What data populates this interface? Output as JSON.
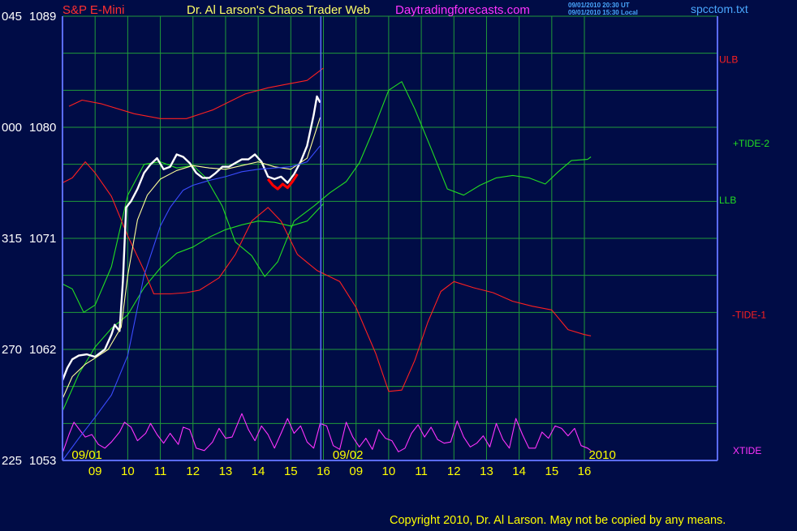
{
  "colors": {
    "background": "#000c46",
    "grid": "#1f9a3a",
    "axis_frame": "#5a6cff",
    "price_text": "#ffffff",
    "axis_label": "#ffff00",
    "title_symbol": "#ff3030",
    "title_main": "#ffff66",
    "website": "#ff33ff",
    "file_name": "#4aa8ff",
    "timestamp": "#4aa8ff",
    "ulb": "#ff2020",
    "llb": "#22dd22",
    "tide_plus2": "#22dd22",
    "tide_minus1": "#ff2020",
    "xtide": "#ff33ff",
    "price": "#ffffff",
    "price_down": "#ff0000",
    "avg_fast": "#ffff99",
    "avg_slow": "#3a4cff",
    "copyright": "#ffff00"
  },
  "header": {
    "symbol": "S&P E-Mini",
    "title": "Dr. Al Larson's Chaos Trader Web",
    "website": "Daytradingforecasts.com",
    "timestamp_ut": "09/01/2010 20:30 UT",
    "timestamp_local": "09/01/2010 15:30 Local",
    "file_name": "spcctom.txt"
  },
  "footer": {
    "copyright": "Copyright 2010, Dr. Al Larson. May not be copied by any means."
  },
  "chart_data": {
    "type": "line",
    "title": "S&P E-Mini",
    "y_axis": {
      "ylim": [
        1053,
        1089
      ],
      "ticks": [
        {
          "value": 1089,
          "left": "045",
          "right": "1089"
        },
        {
          "value": 1080,
          "left": "000",
          "right": "1080"
        },
        {
          "value": 1071,
          "left": "315",
          "right": "1071"
        },
        {
          "value": 1062,
          "left": "270",
          "right": "1062"
        },
        {
          "value": 1053,
          "left": "225",
          "right": "1053"
        }
      ]
    },
    "x_axis": {
      "xlim": [
        0,
        20.08
      ],
      "hour_ticks": [
        {
          "x": 1,
          "label": "09"
        },
        {
          "x": 2,
          "label": "10"
        },
        {
          "x": 3,
          "label": "11"
        },
        {
          "x": 4,
          "label": "12"
        },
        {
          "x": 5,
          "label": "13"
        },
        {
          "x": 6,
          "label": "14"
        },
        {
          "x": 7,
          "label": "15"
        },
        {
          "x": 8,
          "label": "16"
        },
        {
          "x": 9,
          "label": "09"
        },
        {
          "x": 10,
          "label": "10"
        },
        {
          "x": 11,
          "label": "11"
        },
        {
          "x": 12,
          "label": "12"
        },
        {
          "x": 13,
          "label": "13"
        },
        {
          "x": 14,
          "label": "14"
        },
        {
          "x": 15,
          "label": "15"
        },
        {
          "x": 16,
          "label": "16"
        }
      ],
      "date_labels": [
        {
          "x": 0.75,
          "label": "09/01"
        },
        {
          "x": 8.75,
          "label": "09/02"
        },
        {
          "x": 16.55,
          "label": "2010"
        }
      ],
      "day_divider": 7.92
    },
    "grid": true,
    "series_labels": [
      {
        "name": "ULB",
        "color_key": "ulb",
        "y": 1085.5
      },
      {
        "name": "+TIDE-2",
        "color_key": "tide_plus2",
        "y": 1078.7
      },
      {
        "name": "LLB",
        "color_key": "llb",
        "y": 1074.1
      },
      {
        "name": "-TIDE-1",
        "color_key": "tide_minus1",
        "y": 1064.8
      },
      {
        "name": "XTIDE",
        "color_key": "xtide",
        "y": 1053.8
      }
    ],
    "series": [
      {
        "name": "ULB",
        "color_key": "ulb",
        "x": [
          0.2,
          0.6,
          1.2,
          2.2,
          3.0,
          3.8,
          4.6,
          5.6,
          6.3,
          6.9,
          7.5,
          8.0
        ],
        "y": [
          1081.7,
          1082.2,
          1081.9,
          1081.1,
          1080.7,
          1080.7,
          1081.4,
          1082.7,
          1083.2,
          1083.5,
          1083.8,
          1084.8
        ]
      },
      {
        "name": "LLB",
        "color_key": "llb",
        "x": [
          0,
          0.5,
          1.0,
          1.5,
          2.0,
          2.5,
          3.0,
          3.5,
          4.0,
          4.5,
          5.0,
          5.5,
          6.0,
          6.5,
          7.0,
          7.5,
          8.0
        ],
        "y": [
          1057.0,
          1060.0,
          1062.2,
          1063.7,
          1064.8,
          1067.0,
          1068.6,
          1069.8,
          1070.3,
          1071.1,
          1071.7,
          1072.1,
          1072.4,
          1072.3,
          1072.0,
          1072.4,
          1073.8
        ]
      },
      {
        "name": "+TIDE-2",
        "color_key": "tide_plus2",
        "x": [
          0,
          0.3,
          0.65,
          1.0,
          1.5,
          2.0,
          2.5,
          3.0,
          3.5,
          4.0,
          4.4,
          4.9,
          5.3,
          5.8,
          6.2,
          6.6,
          7.1,
          7.7,
          8.2,
          8.7,
          9.1,
          9.5,
          10.0,
          10.4,
          10.8,
          11.3,
          11.8,
          12.3,
          12.8,
          13.3,
          13.8,
          14.3,
          14.8,
          15.2,
          15.6,
          16.1,
          16.2
        ],
        "y": [
          1067.3,
          1066.9,
          1065.0,
          1065.6,
          1068.7,
          1074.5,
          1077.0,
          1077.2,
          1076.7,
          1076.9,
          1075.9,
          1073.6,
          1070.7,
          1069.6,
          1067.9,
          1069.1,
          1072.4,
          1073.6,
          1074.7,
          1075.6,
          1077.1,
          1079.6,
          1083.0,
          1083.7,
          1081.5,
          1078.3,
          1075.0,
          1074.5,
          1075.3,
          1075.9,
          1076.1,
          1075.9,
          1075.4,
          1076.4,
          1077.3,
          1077.4,
          1077.6
        ]
      },
      {
        "name": "-TIDE-1",
        "color_key": "tide_minus1",
        "x": [
          0,
          0.3,
          0.7,
          1.0,
          1.5,
          2.0,
          2.5,
          2.8,
          3.3,
          3.8,
          4.2,
          4.8,
          5.3,
          5.8,
          6.3,
          6.7,
          7.2,
          7.8,
          8.5,
          9.0,
          9.6,
          10.0,
          10.4,
          10.8,
          11.2,
          11.6,
          12.0,
          12.6,
          13.2,
          13.8,
          14.4,
          15.0,
          15.5,
          16.0,
          16.2
        ],
        "y": [
          1075.5,
          1075.9,
          1077.2,
          1076.3,
          1074.4,
          1071.2,
          1068.4,
          1066.5,
          1066.5,
          1066.6,
          1066.8,
          1067.8,
          1069.7,
          1072.4,
          1073.5,
          1072.4,
          1069.7,
          1068.4,
          1067.5,
          1065.4,
          1061.7,
          1058.6,
          1058.7,
          1061.1,
          1064.2,
          1066.7,
          1067.5,
          1067.0,
          1066.6,
          1065.9,
          1065.5,
          1065.2,
          1063.6,
          1063.2,
          1063.1
        ]
      },
      {
        "name": "XTIDE",
        "color_key": "xtide",
        "x": [
          0,
          0.2,
          0.35,
          0.55,
          0.7,
          0.9,
          1.1,
          1.3,
          1.5,
          1.75,
          1.9,
          2.1,
          2.3,
          2.55,
          2.7,
          2.9,
          3.1,
          3.3,
          3.55,
          3.7,
          3.9,
          4.1,
          4.35,
          4.6,
          4.8,
          5.0,
          5.2,
          5.5,
          5.7,
          5.9,
          6.1,
          6.3,
          6.5,
          6.7,
          6.9,
          7.1,
          7.3,
          7.5,
          7.7,
          7.9,
          8.1,
          8.3,
          8.5,
          8.7,
          8.9,
          9.1,
          9.3,
          9.5,
          9.7,
          9.9,
          10.1,
          10.3,
          10.5,
          10.7,
          10.9,
          11.1,
          11.3,
          11.5,
          11.7,
          11.9,
          12.1,
          12.3,
          12.5,
          12.7,
          12.9,
          13.1,
          13.3,
          13.5,
          13.7,
          13.9,
          14.1,
          14.3,
          14.5,
          14.7,
          14.9,
          15.1,
          15.3,
          15.5,
          15.7,
          15.9,
          16.1,
          16.2
        ],
        "y": [
          1053.6,
          1055.1,
          1056.1,
          1055.4,
          1054.9,
          1055.1,
          1054.3,
          1054.0,
          1054.5,
          1055.3,
          1056.1,
          1055.7,
          1054.6,
          1055.2,
          1056.0,
          1055.1,
          1054.4,
          1055.2,
          1054.3,
          1055.7,
          1055.5,
          1054.0,
          1053.8,
          1054.5,
          1055.6,
          1054.8,
          1054.9,
          1056.8,
          1055.5,
          1054.6,
          1055.8,
          1055.1,
          1054.0,
          1055.2,
          1056.4,
          1055.2,
          1055.8,
          1054.5,
          1054.0,
          1056.0,
          1055.8,
          1054.2,
          1053.9,
          1056.1,
          1054.9,
          1054.1,
          1054.8,
          1053.9,
          1055.5,
          1054.8,
          1054.6,
          1053.7,
          1054.0,
          1055.2,
          1055.9,
          1054.9,
          1055.7,
          1054.7,
          1054.4,
          1054.5,
          1056.2,
          1054.9,
          1054.1,
          1054.4,
          1055.0,
          1054.1,
          1056.0,
          1054.7,
          1054.0,
          1056.4,
          1055.1,
          1054.0,
          1054.0,
          1055.3,
          1054.8,
          1055.8,
          1055.6,
          1055.0,
          1055.6,
          1054.2,
          1054.0,
          1053.8
        ]
      },
      {
        "name": "Price",
        "color_key": "price",
        "x": [
          0,
          0.15,
          0.3,
          0.5,
          0.75,
          1.0,
          1.3,
          1.5,
          1.6,
          1.75,
          1.85,
          1.95,
          2.1,
          2.3,
          2.5,
          2.7,
          2.9,
          3.1,
          3.3,
          3.5,
          3.7,
          3.9,
          4.1,
          4.3,
          4.5,
          4.7,
          4.9,
          5.1,
          5.3,
          5.5,
          5.7,
          5.9,
          6.1,
          6.3,
          6.5,
          6.7,
          6.9,
          7.1,
          7.3,
          7.5,
          7.7,
          7.8,
          7.9
        ],
        "y": [
          1059.5,
          1060.5,
          1061.2,
          1061.5,
          1061.6,
          1061.4,
          1062.0,
          1063.2,
          1064.0,
          1063.5,
          1067.5,
          1073.5,
          1074.0,
          1075.0,
          1076.3,
          1077.0,
          1077.5,
          1076.6,
          1076.8,
          1077.8,
          1077.6,
          1077.1,
          1076.3,
          1075.9,
          1075.9,
          1076.3,
          1076.8,
          1076.8,
          1077.1,
          1077.4,
          1077.4,
          1077.8,
          1077.2,
          1076.0,
          1075.8,
          1076.0,
          1075.5,
          1076.2,
          1077.2,
          1078.5,
          1081.0,
          1082.5,
          1082.0
        ]
      },
      {
        "name": "Price-Down",
        "color_key": "price_down",
        "x": [
          6.3,
          6.45,
          6.6,
          6.75,
          6.9,
          7.05,
          7.2
        ],
        "y": [
          1075.8,
          1075.3,
          1075.0,
          1075.4,
          1075.1,
          1075.6,
          1076.2
        ]
      },
      {
        "name": "Avg-Fast",
        "color_key": "avg_fast",
        "x": [
          0,
          0.3,
          0.7,
          1.0,
          1.4,
          1.8,
          2.0,
          2.3,
          2.6,
          3.0,
          3.5,
          4.0,
          4.5,
          5.0,
          5.5,
          6.0,
          6.5,
          7.0,
          7.5,
          7.9
        ],
        "y": [
          1058.0,
          1059.8,
          1060.8,
          1061.3,
          1062.0,
          1063.8,
          1068.0,
          1072.5,
          1074.5,
          1075.8,
          1076.5,
          1076.9,
          1076.7,
          1076.6,
          1076.9,
          1077.2,
          1076.8,
          1076.6,
          1077.5,
          1080.8
        ]
      },
      {
        "name": "Avg-Slow",
        "color_key": "avg_slow",
        "x": [
          0,
          0.5,
          1.0,
          1.5,
          2.0,
          2.5,
          3.0,
          3.3,
          3.7,
          4.0,
          4.5,
          5.0,
          5.5,
          6.0,
          6.5,
          7.0,
          7.5,
          7.9
        ],
        "y": [
          1053.0,
          1054.8,
          1056.5,
          1058.3,
          1061.5,
          1068.0,
          1072.0,
          1073.5,
          1074.9,
          1075.3,
          1075.7,
          1076.0,
          1076.4,
          1076.6,
          1076.7,
          1076.8,
          1077.2,
          1078.5
        ]
      }
    ]
  }
}
